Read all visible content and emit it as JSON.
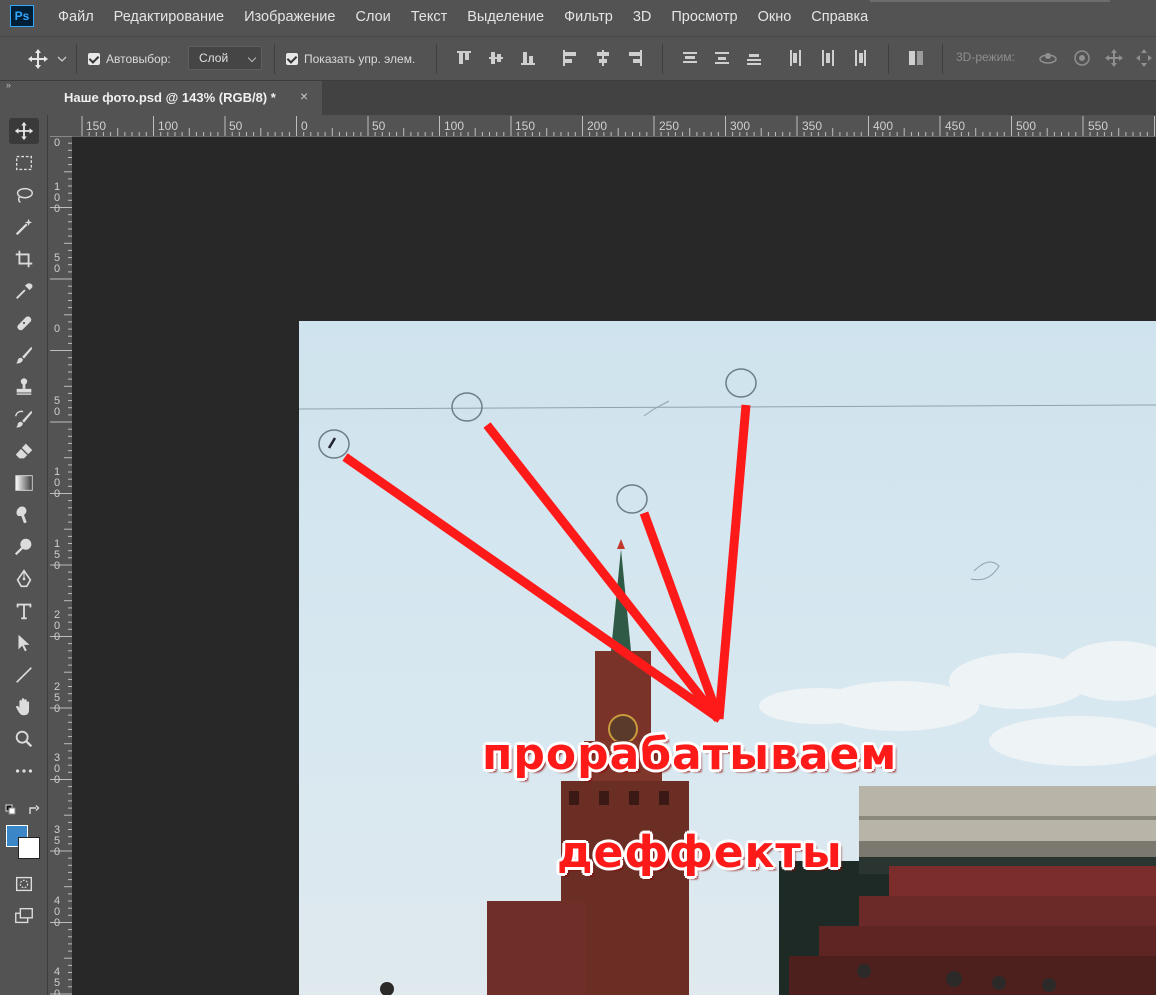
{
  "app": {
    "logo": "Ps"
  },
  "menu": {
    "items": [
      "Файл",
      "Редактирование",
      "Изображение",
      "Слои",
      "Текст",
      "Выделение",
      "Фильтр",
      "3D",
      "Просмотр",
      "Окно",
      "Справка"
    ]
  },
  "options": {
    "auto_select_label": "Автовыбор:",
    "auto_select_checked": true,
    "layer_select_value": "Слой",
    "show_transform_label": "Показать упр. элем.",
    "show_transform_checked": true,
    "mode_3d_label": "3D-режим:"
  },
  "document_tab": {
    "title": "Наше фото.psd @ 143% (RGB/8) *",
    "close": "×"
  },
  "rulers": {
    "horizontal_labels": [
      "150",
      "100",
      "50",
      "0",
      "50",
      "100",
      "150",
      "200",
      "250",
      "300",
      "350",
      "400",
      "450",
      "500",
      "550"
    ],
    "vertical_labels": [
      "0",
      "100",
      "50",
      "0",
      "50",
      "100",
      "150",
      "200",
      "250",
      "300",
      "350",
      "400",
      "450"
    ]
  },
  "tools": [
    "move-tool",
    "marquee-tool",
    "lasso-tool",
    "magic-wand-tool",
    "crop-tool",
    "eyedropper-tool",
    "healing-brush-tool",
    "brush-tool",
    "clone-stamp-tool",
    "history-brush-tool",
    "eraser-tool",
    "gradient-tool",
    "blur-tool",
    "dodge-tool",
    "pen-tool",
    "type-tool",
    "path-selection-tool",
    "line-tool",
    "hand-tool",
    "zoom-tool",
    "more-tools"
  ],
  "colors": {
    "foreground": "#3a86c6",
    "background": "#ffffff",
    "annotation_red": "#ff1a1a"
  },
  "photo_annotation": {
    "line1": "прорабатываем",
    "line2": "деффекты"
  }
}
